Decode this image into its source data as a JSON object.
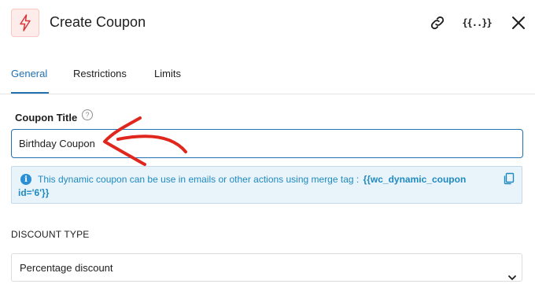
{
  "header": {
    "title": "Create Coupon",
    "merge_tag_glyph": "{{..}}",
    "icons": [
      "bolt-icon",
      "link-icon",
      "merge-tags-icon",
      "close-icon"
    ]
  },
  "tabs": [
    {
      "label": "General",
      "active": true
    },
    {
      "label": "Restrictions",
      "active": false
    },
    {
      "label": "Limits",
      "active": false
    }
  ],
  "coupon_title": {
    "label": "Coupon Title",
    "help_glyph": "?",
    "value": "Birthday Coupon"
  },
  "notice": {
    "icon_glyph": "i",
    "lead": "This dynamic coupon can be use in emails or other actions using merge tag :",
    "merge_tag_part1": "{{wc_dynamic_coupon",
    "merge_tag_part2": "id='6'}}"
  },
  "discount": {
    "label": "DISCOUNT TYPE",
    "selected": "Percentage discount"
  },
  "colors": {
    "accent": "#2271b1",
    "notice_bg": "#e9f3fa",
    "notice_text": "#1f8ac0",
    "annotation_arrow": "#e0271e",
    "logo_bg": "#fdecea"
  }
}
